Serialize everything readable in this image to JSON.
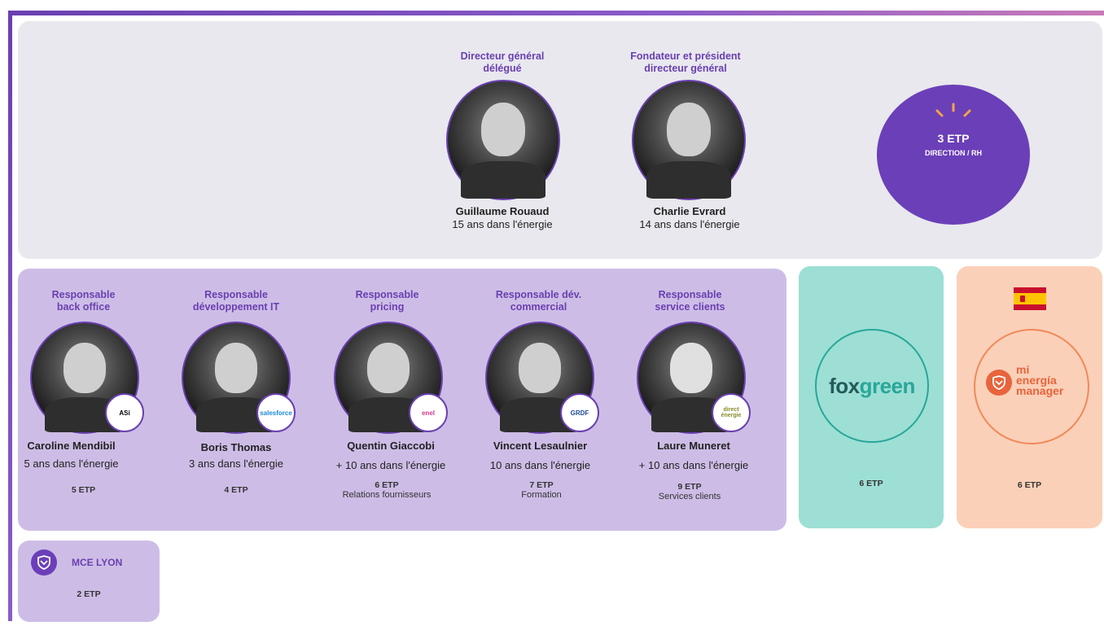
{
  "executives": [
    {
      "role": "Directeur général délégué",
      "name": "Guillaume Rouaud",
      "experience": "15 ans dans l'énergie"
    },
    {
      "role": "Fondateur et président directeur général",
      "name": "Charlie Evrard",
      "experience": "14 ans dans l'énergie"
    }
  ],
  "direction": {
    "etp": "3 ETP",
    "label": "DIRECTION / RH"
  },
  "managers": [
    {
      "role": "Responsable back office",
      "name": "Caroline Mendibil",
      "experience": "5 ans dans l'énergie",
      "etp": "5 ETP",
      "sub": "",
      "badge": "ASi"
    },
    {
      "role": "Responsable développement IT",
      "name": "Boris Thomas",
      "experience": "3 ans dans l'énergie",
      "etp": "4 ETP",
      "sub": "",
      "badge": "salesforce"
    },
    {
      "role": "Responsable pricing",
      "name": "Quentin Giaccobi",
      "experience": "+ 10 ans dans l'énergie",
      "etp": "6 ETP",
      "sub": "Relations fournisseurs",
      "badge": "enel"
    },
    {
      "role": "Responsable dév. commercial",
      "name": "Vincent Lesaulnier",
      "experience": "10 ans dans l'énergie",
      "etp": "7 ETP",
      "sub": "Formation",
      "badge": "GRDF"
    },
    {
      "role": "Responsable service clients",
      "name": "Laure Muneret",
      "experience": "+ 10 ans dans l'énergie",
      "etp": "9 ETP",
      "sub": "Services clients",
      "badge": "direct énergie"
    }
  ],
  "foxgreen": {
    "logo_a": "fox",
    "logo_b": "green",
    "etp": "6 ETP"
  },
  "spain": {
    "logo_line1": "mi",
    "logo_line2": "energía",
    "logo_line3": "manager",
    "etp": "6 ETP"
  },
  "lyon": {
    "title": "MCE LYON",
    "etp": "2 ETP"
  },
  "colors": {
    "purple": "#6a3fb0",
    "lavender": "#cdbde6",
    "teal": "#9ddfd4",
    "peach": "#fbd0b8",
    "grey": "#e8e8ee"
  }
}
